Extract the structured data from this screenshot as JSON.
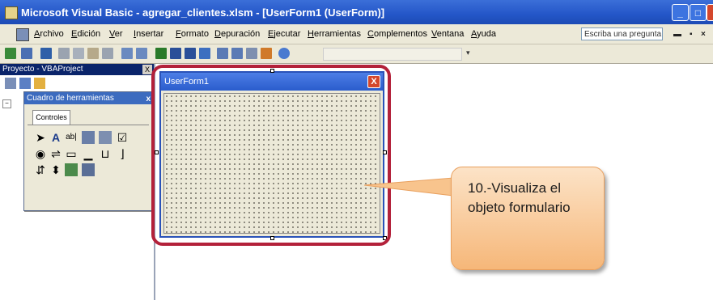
{
  "window": {
    "title": "Microsoft Visual Basic - agregar_clientes.xlsm - [UserForm1 (UserForm)]"
  },
  "menu": {
    "items": [
      "Archivo",
      "Edición",
      "Ver",
      "Insertar",
      "Formato",
      "Depuración",
      "Ejecutar",
      "Herramientas",
      "Complementos",
      "Ventana",
      "Ayuda"
    ],
    "ask_placeholder": "Escriba una pregunta"
  },
  "project_pane": {
    "title": "Proyecto - VBAProject",
    "close": "X"
  },
  "toolbox": {
    "title": "Cuadro de herramientas",
    "close": "x",
    "tab": "Controles"
  },
  "userform": {
    "title": "UserForm1",
    "close": "X"
  },
  "callout": {
    "text": "10.-Visualiza el objeto formulario"
  },
  "colors": {
    "highlight": "#b3213a",
    "callout_fill": "#f6b779",
    "titlebar": "#2456c8"
  }
}
